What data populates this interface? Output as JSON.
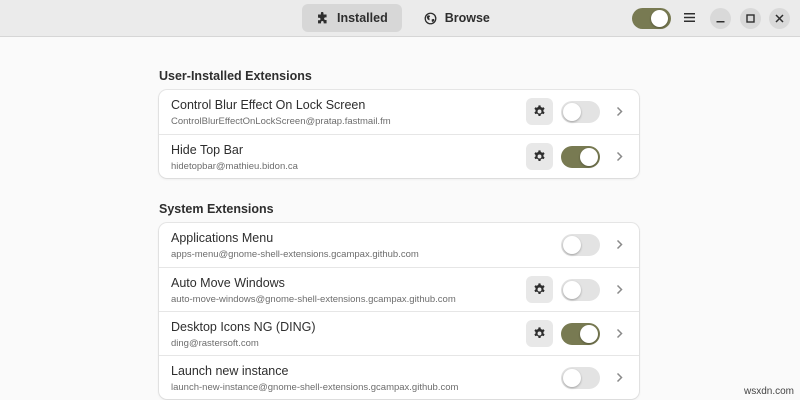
{
  "header": {
    "tabs": [
      {
        "label": "Installed",
        "icon": "puzzle-piece-icon",
        "active": true
      },
      {
        "label": "Browse",
        "icon": "globe-icon",
        "active": false
      }
    ],
    "global_toggle_on": true,
    "accent_color": "#787a52"
  },
  "sections": {
    "user": {
      "title": "User-Installed Extensions",
      "items": [
        {
          "name": "Control Blur Effect On Lock Screen",
          "id": "ControlBlurEffectOnLockScreen@pratap.fastmail.fm",
          "has_settings": true,
          "enabled": false
        },
        {
          "name": "Hide Top Bar",
          "id": "hidetopbar@mathieu.bidon.ca",
          "has_settings": true,
          "enabled": true
        }
      ]
    },
    "system": {
      "title": "System Extensions",
      "items": [
        {
          "name": "Applications Menu",
          "id": "apps-menu@gnome-shell-extensions.gcampax.github.com",
          "has_settings": false,
          "enabled": false
        },
        {
          "name": "Auto Move Windows",
          "id": "auto-move-windows@gnome-shell-extensions.gcampax.github.com",
          "has_settings": true,
          "enabled": false
        },
        {
          "name": "Desktop Icons NG (DING)",
          "id": "ding@rastersoft.com",
          "has_settings": true,
          "enabled": true
        },
        {
          "name": "Launch new instance",
          "id": "launch-new-instance@gnome-shell-extensions.gcampax.github.com",
          "has_settings": false,
          "enabled": false
        }
      ]
    }
  },
  "watermark": "wsxdn.com"
}
